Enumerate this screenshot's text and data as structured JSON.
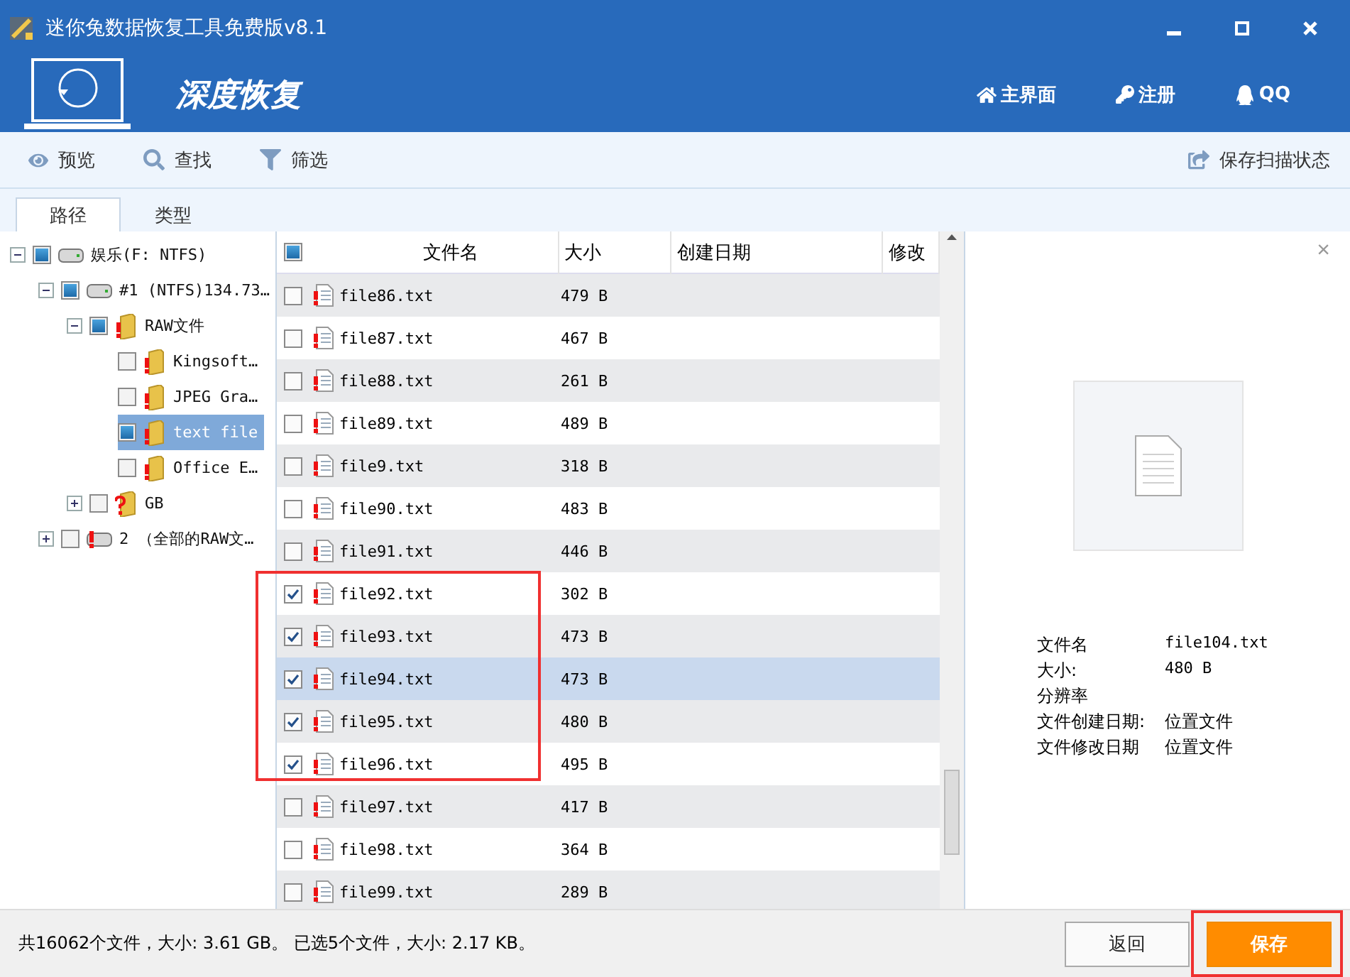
{
  "window": {
    "title": "迷你兔数据恢复工具免费版v8.1"
  },
  "header": {
    "mode": "深度恢复",
    "nav": [
      {
        "kind": "home",
        "label": "主界面"
      },
      {
        "kind": "key",
        "label": "注册"
      },
      {
        "kind": "qq",
        "label": "QQ"
      }
    ]
  },
  "toolbar": {
    "items": [
      {
        "kind": "eye",
        "label": "预览"
      },
      {
        "kind": "search",
        "label": "查找"
      },
      {
        "kind": "filter",
        "label": "筛选"
      }
    ],
    "save_scan": "保存扫描状态"
  },
  "tabs": [
    {
      "label": "路径",
      "selected": true
    },
    {
      "label": "类型",
      "selected": false
    }
  ],
  "tree": [
    {
      "label": "娱乐(F: NTFS)",
      "kind": "drive",
      "checked": true,
      "expanded": true,
      "selected": false,
      "children": [
        {
          "label": "#1  (NTFS)134.73…",
          "kind": "drive",
          "checked": true,
          "expanded": true,
          "selected": false,
          "children": [
            {
              "label": "RAW文件",
              "kind": "folder",
              "checked": true,
              "expanded": true,
              "selected": false,
              "children": [
                {
                  "label": "Kingsoft…",
                  "kind": "folder",
                  "checked": false,
                  "selected": false
                },
                {
                  "label": "JPEG Gra…",
                  "kind": "folder",
                  "checked": false,
                  "selected": false
                },
                {
                  "label": "text file",
                  "kind": "folder",
                  "checked": true,
                  "selected": true
                },
                {
                  "label": "Office E…",
                  "kind": "folder",
                  "checked": false,
                  "selected": false
                }
              ]
            },
            {
              "label": "GB",
              "kind": "unknown",
              "checked": false,
              "expanded": false,
              "selected": false
            }
          ]
        },
        {
          "label": "2 （全部的RAW文…",
          "kind": "raw",
          "checked": false,
          "expanded": false,
          "selected": false
        }
      ]
    }
  ],
  "table": {
    "select_all": true,
    "columns": [
      "文件名",
      "大小",
      "创建日期",
      "修改"
    ],
    "rows": [
      {
        "name": "file86.txt",
        "size": "479 B",
        "checked": false,
        "selected": false
      },
      {
        "name": "file87.txt",
        "size": "467 B",
        "checked": false,
        "selected": false
      },
      {
        "name": "file88.txt",
        "size": "261 B",
        "checked": false,
        "selected": false
      },
      {
        "name": "file89.txt",
        "size": "489 B",
        "checked": false,
        "selected": false
      },
      {
        "name": "file9.txt",
        "size": "318 B",
        "checked": false,
        "selected": false
      },
      {
        "name": "file90.txt",
        "size": "483 B",
        "checked": false,
        "selected": false
      },
      {
        "name": "file91.txt",
        "size": "446 B",
        "checked": false,
        "selected": false
      },
      {
        "name": "file92.txt",
        "size": "302 B",
        "checked": true,
        "selected": false
      },
      {
        "name": "file93.txt",
        "size": "473 B",
        "checked": true,
        "selected": false
      },
      {
        "name": "file94.txt",
        "size": "473 B",
        "checked": true,
        "selected": true
      },
      {
        "name": "file95.txt",
        "size": "480 B",
        "checked": true,
        "selected": false
      },
      {
        "name": "file96.txt",
        "size": "495 B",
        "checked": true,
        "selected": false
      },
      {
        "name": "file97.txt",
        "size": "417 B",
        "checked": false,
        "selected": false
      },
      {
        "name": "file98.txt",
        "size": "364 B",
        "checked": false,
        "selected": false
      },
      {
        "name": "file99.txt",
        "size": "289 B",
        "checked": false,
        "selected": false
      }
    ]
  },
  "preview": {
    "close": "×",
    "details": [
      {
        "label": "文件名",
        "value": "file104.txt"
      },
      {
        "label": "大小:",
        "value": "480 B"
      },
      {
        "label": "分辨率"
      },
      {
        "label": "文件创建日期:",
        "value": "位置文件"
      },
      {
        "label": "文件修改日期",
        "value": "位置文件"
      }
    ]
  },
  "status_bar": {
    "summary": "共16062个文件，大小: 3.61 GB。 已选5个文件，大小: 2.17 KB。",
    "buttons": [
      {
        "label": "返回",
        "kind": "secondary"
      },
      {
        "label": "保存",
        "kind": "primary"
      }
    ]
  }
}
